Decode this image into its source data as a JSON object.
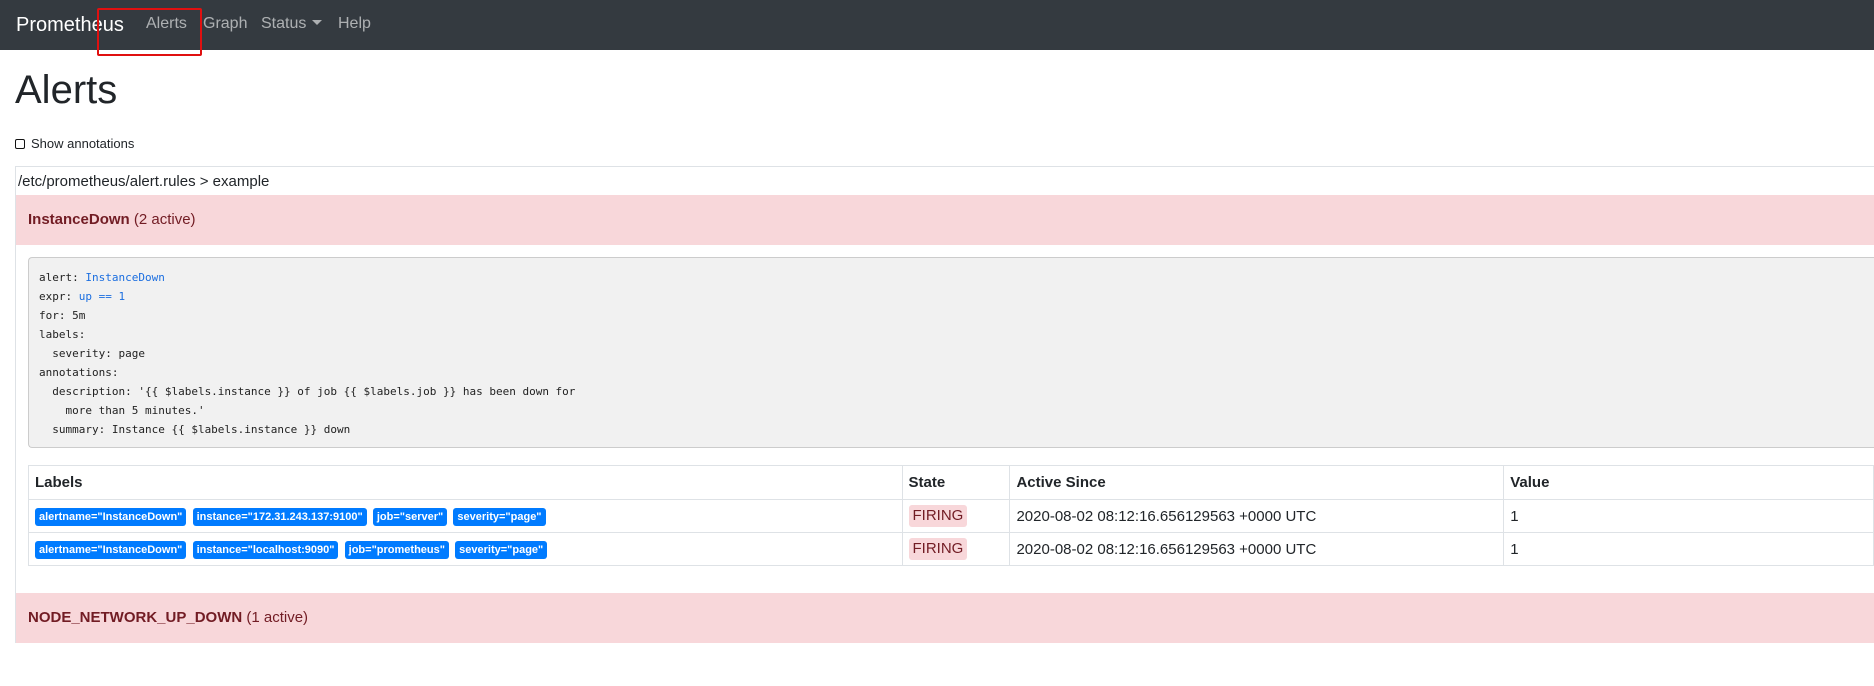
{
  "nav": {
    "brand": "Prometheus",
    "items": [
      "Alerts",
      "Graph",
      "Status",
      "Help"
    ]
  },
  "page": {
    "title": "Alerts",
    "show_annotations_label": "Show annotations",
    "show_annotations_checked": false
  },
  "rule_file": {
    "path": "/etc/prometheus/alert.rules > example"
  },
  "groups": [
    {
      "name": "InstanceDown",
      "count_text": "(2 active)",
      "rule": {
        "alert_key": "alert: ",
        "alert_val": "InstanceDown",
        "expr_key": "expr: ",
        "expr_val": "up == 1",
        "rest": "for: 5m\nlabels:\n  severity: page\nannotations:\n  description: '{{ $labels.instance }} of job {{ $labels.job }} has been down for\n    more than 5 minutes.'\n  summary: Instance {{ $labels.instance }} down"
      },
      "table": {
        "headers": [
          "Labels",
          "State",
          "Active Since",
          "Value"
        ],
        "rows": [
          {
            "labels": [
              "alertname=\"InstanceDown\"",
              "instance=\"172.31.243.137:9100\"",
              "job=\"server\"",
              "severity=\"page\""
            ],
            "state": "FIRING",
            "active_since": "2020-08-02 08:12:16.656129563 +0000 UTC",
            "value": "1"
          },
          {
            "labels": [
              "alertname=\"InstanceDown\"",
              "instance=\"localhost:9090\"",
              "job=\"prometheus\"",
              "severity=\"page\""
            ],
            "state": "FIRING",
            "active_since": "2020-08-02 08:12:16.656129563 +0000 UTC",
            "value": "1"
          }
        ]
      }
    },
    {
      "name": "NODE_NETWORK_UP_DOWN",
      "count_text": "(1 active)"
    }
  ],
  "colors": {
    "navbar_bg": "#343a40",
    "alert_bg": "#f8d7da",
    "alert_text": "#721c24",
    "badge_bg": "#007bff",
    "highlight_box": "#e01010"
  }
}
